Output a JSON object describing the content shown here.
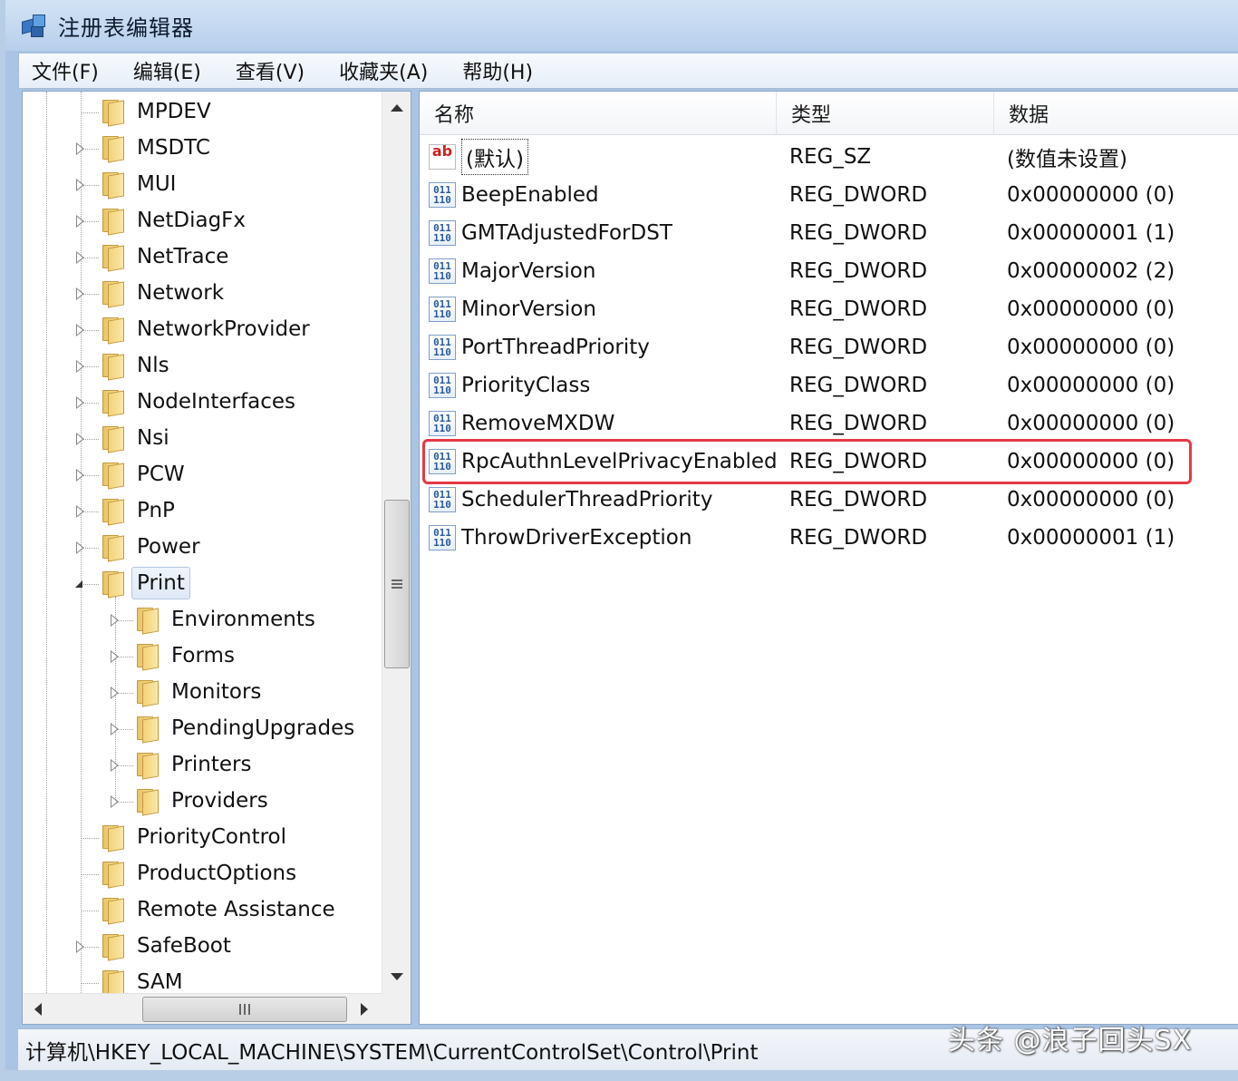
{
  "window": {
    "title": "注册表编辑器"
  },
  "menu": [
    "文件(F)",
    "编辑(E)",
    "查看(V)",
    "收藏夹(A)",
    "帮助(H)"
  ],
  "tree": {
    "items": [
      {
        "label": "MPDEV",
        "level": 0,
        "expander": "none"
      },
      {
        "label": "MSDTC",
        "level": 0,
        "expander": "closed"
      },
      {
        "label": "MUI",
        "level": 0,
        "expander": "closed"
      },
      {
        "label": "NetDiagFx",
        "level": 0,
        "expander": "closed"
      },
      {
        "label": "NetTrace",
        "level": 0,
        "expander": "closed"
      },
      {
        "label": "Network",
        "level": 0,
        "expander": "closed"
      },
      {
        "label": "NetworkProvider",
        "level": 0,
        "expander": "closed"
      },
      {
        "label": "Nls",
        "level": 0,
        "expander": "closed"
      },
      {
        "label": "NodeInterfaces",
        "level": 0,
        "expander": "closed"
      },
      {
        "label": "Nsi",
        "level": 0,
        "expander": "closed"
      },
      {
        "label": "PCW",
        "level": 0,
        "expander": "closed"
      },
      {
        "label": "PnP",
        "level": 0,
        "expander": "closed"
      },
      {
        "label": "Power",
        "level": 0,
        "expander": "closed"
      },
      {
        "label": "Print",
        "level": 0,
        "expander": "open",
        "selected": true
      },
      {
        "label": "Environments",
        "level": 1,
        "expander": "closed"
      },
      {
        "label": "Forms",
        "level": 1,
        "expander": "closed"
      },
      {
        "label": "Monitors",
        "level": 1,
        "expander": "closed"
      },
      {
        "label": "PendingUpgrades",
        "level": 1,
        "expander": "closed"
      },
      {
        "label": "Printers",
        "level": 1,
        "expander": "closed"
      },
      {
        "label": "Providers",
        "level": 1,
        "expander": "closed"
      },
      {
        "label": "PriorityControl",
        "level": 0,
        "expander": "none"
      },
      {
        "label": "ProductOptions",
        "level": 0,
        "expander": "none"
      },
      {
        "label": "Remote Assistance",
        "level": 0,
        "expander": "none"
      },
      {
        "label": "SafeBoot",
        "level": 0,
        "expander": "closed"
      },
      {
        "label": "SAM",
        "level": 0,
        "expander": "none"
      }
    ]
  },
  "list": {
    "columns": [
      "名称",
      "类型",
      "数据"
    ],
    "rows": [
      {
        "name": "(默认)",
        "type": "REG_SZ",
        "data": "(数值未设置)",
        "icon": "sz",
        "focused": true
      },
      {
        "name": "BeepEnabled",
        "type": "REG_DWORD",
        "data": "0x00000000 (0)",
        "icon": "dword"
      },
      {
        "name": "GMTAdjustedForDST",
        "type": "REG_DWORD",
        "data": "0x00000001 (1)",
        "icon": "dword"
      },
      {
        "name": "MajorVersion",
        "type": "REG_DWORD",
        "data": "0x00000002 (2)",
        "icon": "dword"
      },
      {
        "name": "MinorVersion",
        "type": "REG_DWORD",
        "data": "0x00000000 (0)",
        "icon": "dword"
      },
      {
        "name": "PortThreadPriority",
        "type": "REG_DWORD",
        "data": "0x00000000 (0)",
        "icon": "dword"
      },
      {
        "name": "PriorityClass",
        "type": "REG_DWORD",
        "data": "0x00000000 (0)",
        "icon": "dword"
      },
      {
        "name": "RemoveMXDW",
        "type": "REG_DWORD",
        "data": "0x00000000 (0)",
        "icon": "dword"
      },
      {
        "name": "RpcAuthnLevelPrivacyEnabled",
        "type": "REG_DWORD",
        "data": "0x00000000 (0)",
        "icon": "dword",
        "highlighted": true
      },
      {
        "name": "SchedulerThreadPriority",
        "type": "REG_DWORD",
        "data": "0x00000000 (0)",
        "icon": "dword"
      },
      {
        "name": "ThrowDriverException",
        "type": "REG_DWORD",
        "data": "0x00000001 (1)",
        "icon": "dword"
      }
    ]
  },
  "icons": {
    "sz_glyph": "ab",
    "dword_glyph": "011\n110"
  },
  "status": {
    "path": "计算机\\HKEY_LOCAL_MACHINE\\SYSTEM\\CurrentControlSet\\Control\\Print"
  },
  "watermark": "头条 @浪子回头SX",
  "colors": {
    "highlight": "#e53946",
    "titlebar": "#b7cfec",
    "selection": "#dfe9f6"
  }
}
